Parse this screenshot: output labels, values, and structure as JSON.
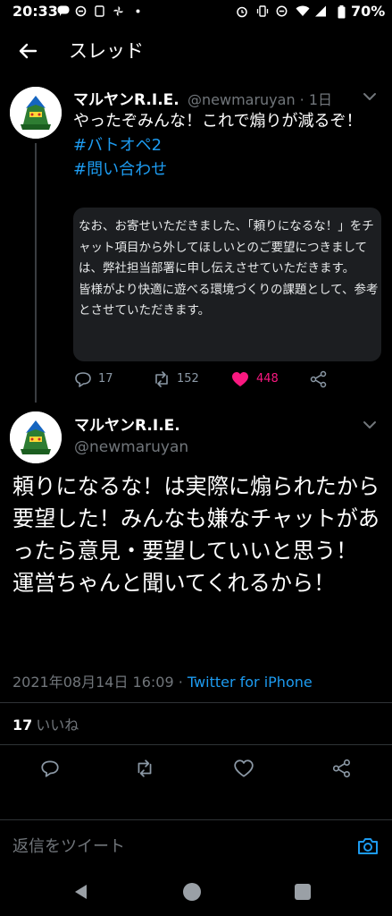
{
  "status_bar": {
    "time": "20:33",
    "battery": "70%"
  },
  "header": {
    "title": "スレッド"
  },
  "tweets": [
    {
      "name": "マルヤンR.I.E.",
      "handle_time": "@newmaruyan · 1日",
      "text": "やったぞみんな！これで煽りが減るぞ！",
      "hashtags": [
        "#バトオペ2",
        "#問い合わせ"
      ],
      "image_text": "なお、お寄せいただきました、「頼りになるな！」をチャット項目から外してほしいとのご要望につきましては、弊社担当部署に申し伝えさせていただきます。\n皆様がより快適に遊べる環境づくりの課題として、参考とさせていただきます。",
      "reply_count": "17",
      "retweet_count": "152",
      "like_count": "448"
    },
    {
      "name": "マルヤンR.I.E.",
      "handle": "@newmaruyan",
      "text": "頼りになるな！は実際に煽られたから要望した！みんなも嫌なチャットがあったら意見・要望していいと思う！\n運営ちゃんと聞いてくれるから！",
      "timestamp": "2021年08月14日 16:09 · ",
      "source": "Twitter for iPhone",
      "likes_count": "17",
      "likes_label": "いいね"
    }
  ],
  "reply_bar": {
    "placeholder": "返信をツイート"
  },
  "colors": {
    "background": "#000000",
    "accent": "#1d9bf0",
    "like_red": "#f91880",
    "muted": "#71767b"
  },
  "icons": [
    "back-arrow-icon",
    "more-icon",
    "reply-icon",
    "retweet-icon",
    "heart-icon",
    "share-icon",
    "camera-icon",
    "nav-back-icon",
    "nav-home-icon",
    "nav-recents-icon"
  ]
}
